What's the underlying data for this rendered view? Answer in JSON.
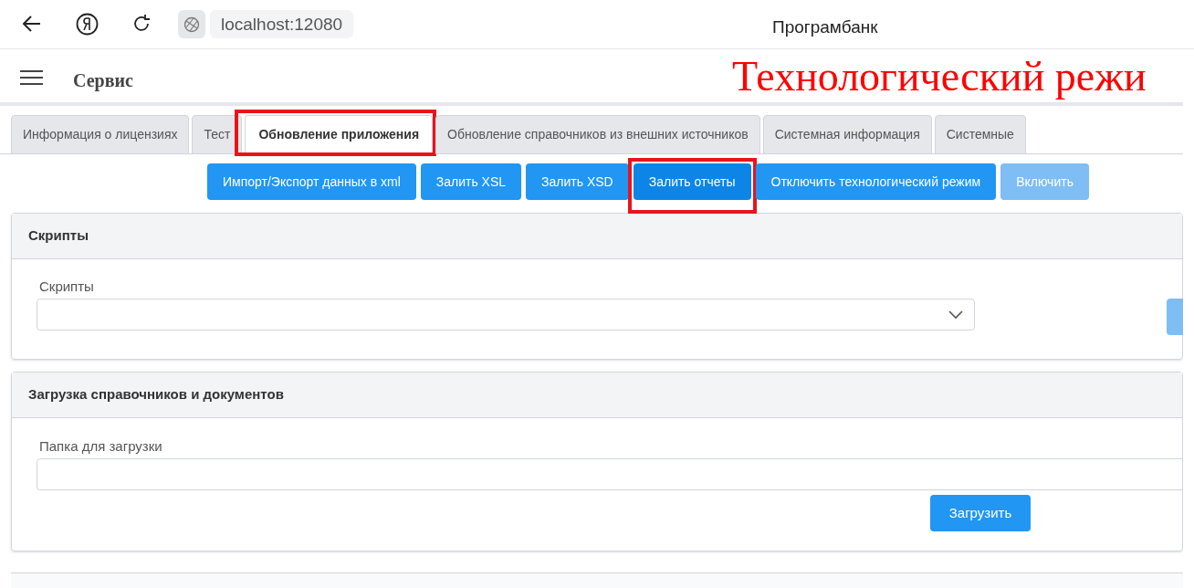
{
  "browser": {
    "url": "localhost:12080",
    "title": "Програмбанк"
  },
  "header": {
    "menu_title": "Сервис",
    "mode_banner": "Технологический режи"
  },
  "tabs": [
    {
      "label": "Информация о лицензиях",
      "selected": false,
      "highlighted": false
    },
    {
      "label": "Тест",
      "selected": false,
      "highlighted": false
    },
    {
      "label": "Обновление приложения",
      "selected": true,
      "highlighted": true
    },
    {
      "label": "Обновление справочников из внешних источников",
      "selected": false,
      "highlighted": false
    },
    {
      "label": "Системная информация",
      "selected": false,
      "highlighted": false
    },
    {
      "label": "Системные",
      "selected": false,
      "highlighted": false
    }
  ],
  "actions": [
    {
      "label": "Импорт/Экспорт данных в xml",
      "focused": false,
      "disabled": false,
      "highlighted": false
    },
    {
      "label": "Залить XSL",
      "focused": false,
      "disabled": false,
      "highlighted": false
    },
    {
      "label": "Залить XSD",
      "focused": false,
      "disabled": false,
      "highlighted": false
    },
    {
      "label": "Залить отчеты",
      "focused": true,
      "disabled": false,
      "highlighted": true
    },
    {
      "label": "Отключить технологический режим",
      "focused": false,
      "disabled": false,
      "highlighted": false
    },
    {
      "label": "Включить",
      "focused": false,
      "disabled": true,
      "highlighted": false
    }
  ],
  "scripts_card": {
    "title": "Скрипты",
    "field_label": "Скрипты"
  },
  "upload_card": {
    "title": "Загрузка справочников и документов",
    "field_label": "Папка для загрузки",
    "button": "Загрузить"
  }
}
